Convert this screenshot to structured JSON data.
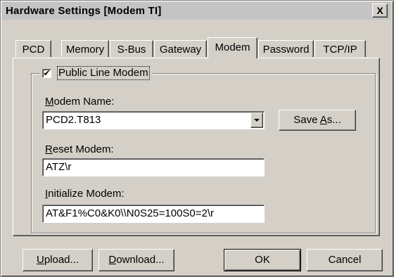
{
  "window": {
    "title": "Hardware Settings [Modem TI]",
    "close_glyph": "X"
  },
  "tabs": [
    {
      "label": "PCD",
      "active": false
    },
    {
      "label": "Memory",
      "active": false
    },
    {
      "label": "S-Bus",
      "active": false
    },
    {
      "label": "Gateway",
      "active": false
    },
    {
      "label": "Modem",
      "active": true
    },
    {
      "label": "Password",
      "active": false
    },
    {
      "label": "TCP/IP",
      "active": false
    }
  ],
  "modem_group": {
    "checkbox_label": "Public Line Modem",
    "checkbox_checked": true,
    "checkbox_glyph": "✔",
    "modem_name": {
      "label_ul": "M",
      "label_rest": "odem Name:",
      "value": "PCD2.T813"
    },
    "save_as": {
      "pre": "Save ",
      "ul": "A",
      "post": "s..."
    },
    "reset_modem": {
      "label_ul": "R",
      "label_rest": "eset Modem:",
      "value": "ATZ\\r"
    },
    "initialize_modem": {
      "label_ul": "I",
      "label_rest": "nitialize Modem:",
      "value": "AT&F1%C0&K0\\\\N0S25=100S0=2\\r"
    }
  },
  "footer": {
    "upload": {
      "ul": "U",
      "rest": "pload..."
    },
    "download": {
      "ul": "D",
      "rest": "ownload..."
    },
    "ok": "OK",
    "cancel": "Cancel"
  }
}
